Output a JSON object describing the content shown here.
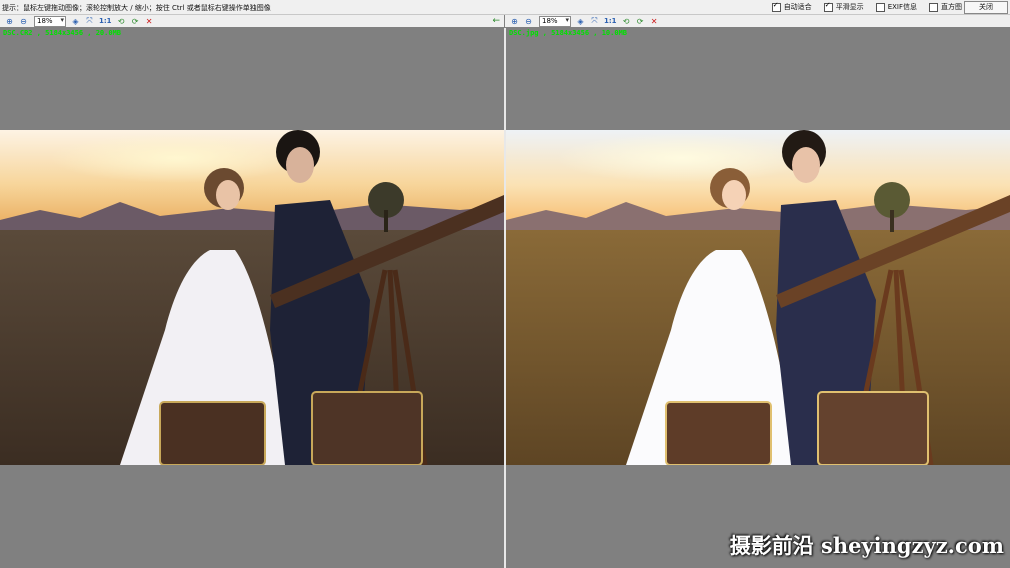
{
  "hint": "提示：鼠标左键拖动图像；滚轮控制放大 / 缩小；按住 Ctrl 或者鼠标右键操作单独图像",
  "options": [
    {
      "label": "自动适合",
      "checked": true
    },
    {
      "label": "平滑显示",
      "checked": true
    },
    {
      "label": "EXIF信息",
      "checked": false
    },
    {
      "label": "直方图",
      "checked": false
    }
  ],
  "close_label": "关闭",
  "toolbar": {
    "zoom_value": "18%",
    "one_to_one": "1:1",
    "icons": [
      "zoom-in-icon",
      "zoom-out-icon",
      "zoom-select-icon",
      "prev-icon",
      "fit-icon",
      "one-to-one",
      "rotate-left-icon",
      "rotate-right-icon",
      "delete-icon"
    ]
  },
  "left_pane": {
    "file_info": "DSC.CR2 , 5184x3456 , 20.0MB"
  },
  "right_pane": {
    "file_info": "DSC.jpg , 5184x3456 , 10.0MB"
  },
  "watermark": "摄影前沿 sheyingzyz.com"
}
